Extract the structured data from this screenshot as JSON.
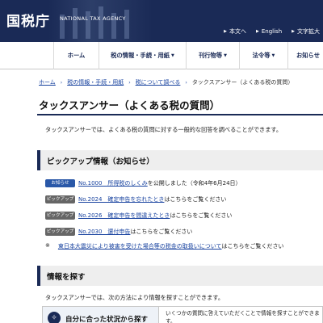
{
  "header": {
    "logo_text": "国税庁",
    "logo_sub": "NATIONAL TAX AGENCY",
    "util": [
      {
        "label": "本文へ"
      },
      {
        "label": "English"
      },
      {
        "label": "文字拡大"
      }
    ],
    "colors": {
      "band": "#1a2a56",
      "link": "#1a44a0",
      "info_badge": "#2a58a8",
      "pickup_badge": "#666666"
    }
  },
  "gnav": [
    {
      "label": "ホーム"
    },
    {
      "label": "税の情報・手続・用紙"
    },
    {
      "label": "刊行物等"
    },
    {
      "label": "法令等"
    },
    {
      "label": "お知らせ"
    }
  ],
  "breadcrumb": [
    "ホーム",
    "税の情報・手続・用紙",
    "税について調べる",
    "タックスアンサー（よくある税の質問）"
  ],
  "page": {
    "title": "タックスアンサー（よくある税の質問）",
    "lead": "タックスアンサーでは、よくある税の質問に対する一般的な回答を調べることができます。"
  },
  "pickup": {
    "heading": "ピックアップ情報（お知らせ）",
    "items": [
      {
        "badge": "お知らせ",
        "link": "No.1000　所得税のしくみ",
        "text": "を公開しました（令和4年6月24日）"
      },
      {
        "badge": "ピックアップ",
        "link": "No.2024　確定申告を忘れたとき",
        "text": "はこちらをご覧ください"
      },
      {
        "badge": "ピックアップ",
        "link": "No.2026　確定申告を間違えたとき",
        "text": "はこちらをご覧ください"
      },
      {
        "badge": "ピックアップ",
        "link": "No.2030　還付申告",
        "text": "はこちらをご覧ください"
      }
    ],
    "note_mark": "※",
    "note_link": "東日本大震災により被害を受けた場合等の税金の取扱いについて",
    "note_text": "はこちらをご覧ください"
  },
  "search": {
    "heading": "情報を探す",
    "lead": "タックスアンサーでは、次の方法により情報を探すことができます。",
    "panel_title": "自分に合った状況から探す",
    "panel_desc": "いくつかの質問に答えていただくことで情報を探すことができます。"
  }
}
